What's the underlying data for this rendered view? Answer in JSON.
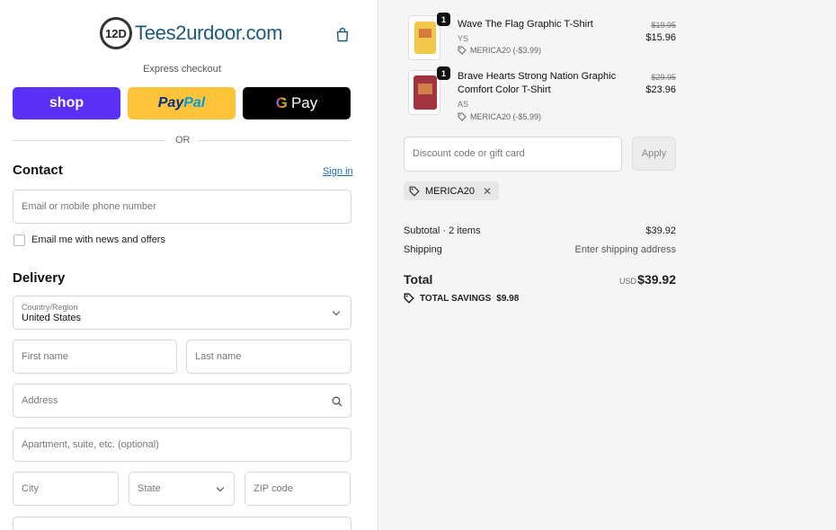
{
  "header": {
    "logo_badge": "12D",
    "logo_text": "Tees2urdoor.com"
  },
  "express": {
    "title": "Express checkout",
    "shop_label": "shop",
    "paypal_label_1": "Pay",
    "paypal_label_2": "Pal",
    "gpay_g": "G",
    "gpay_label": "Pay",
    "or_label": "OR"
  },
  "contact": {
    "title": "Contact",
    "sign_in": "Sign in",
    "email_placeholder": "Email or mobile phone number",
    "newsletter_label": "Email me with news and offers"
  },
  "delivery": {
    "title": "Delivery",
    "country_label": "Country/Region",
    "country_value": "United States",
    "first_name": "First name",
    "last_name": "Last name",
    "address": "Address",
    "apartment": "Apartment, suite, etc. (optional)",
    "city": "City",
    "state": "State",
    "zip": "ZIP code"
  },
  "cart": {
    "items": [
      {
        "qty": "1",
        "title": "Wave The Flag Graphic T-Shirt",
        "variant": "YS",
        "discount": "MERICA20 (-$3.99)",
        "old_price": "$19.95",
        "price": "$15.96"
      },
      {
        "qty": "1",
        "title_1": "Brave Hearts Strong Nation Graphic",
        "title_2": "Comfort Color T-Shirt",
        "variant": "AS",
        "discount": "MERICA20 (-$5.99)",
        "old_price": "$29.95",
        "price": "$23.96"
      }
    ],
    "discount_placeholder": "Discount code or gift card",
    "apply_label": "Apply",
    "applied_code": "MERICA20",
    "subtotal_label": "Subtotal · 2 items",
    "subtotal_value": "$39.92",
    "shipping_label": "Shipping",
    "shipping_value": "Enter shipping address",
    "total_label": "Total",
    "total_currency": "USD",
    "total_value": "$39.92",
    "savings_label": "TOTAL SAVINGS",
    "savings_value": "$9.98"
  },
  "colors": {
    "shop": "#5a31f4",
    "paypal": "#ffc439",
    "gpay": "#000000",
    "link": "#1c6bb5",
    "logo_text": "#1c5a7a"
  },
  "icons": [
    "bag-icon",
    "search-icon",
    "chevron-down-icon",
    "tag-icon",
    "close-icon"
  ]
}
